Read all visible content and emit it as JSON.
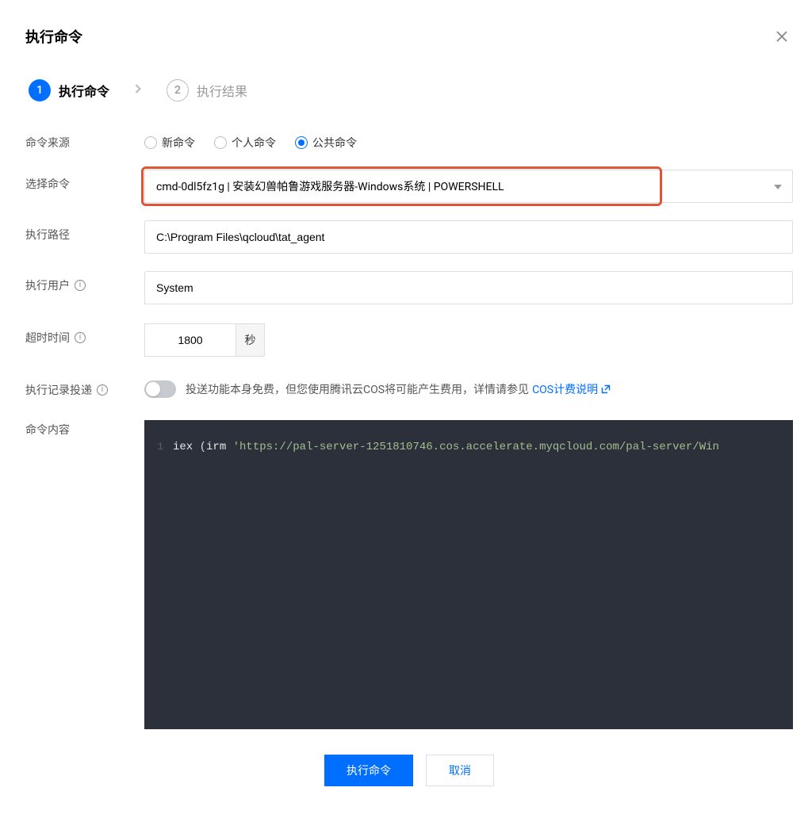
{
  "header": {
    "title": "执行命令"
  },
  "steps": {
    "s1": {
      "num": "1",
      "label": "执行命令"
    },
    "s2": {
      "num": "2",
      "label": "执行结果"
    }
  },
  "labels": {
    "source": "命令来源",
    "select": "选择命令",
    "path": "执行路径",
    "user": "执行用户",
    "timeout": "超时时间",
    "delivery": "执行记录投递",
    "content": "命令内容"
  },
  "source_options": {
    "new": "新命令",
    "personal": "个人命令",
    "public": "公共命令"
  },
  "select_command": {
    "value": "cmd-0dl5fz1g | 安装幻兽帕鲁游戏服务器-Windows系统 | POWERSHELL"
  },
  "path": {
    "value": "C:\\Program Files\\qcloud\\tat_agent"
  },
  "user": {
    "value": "System"
  },
  "timeout": {
    "value": "1800",
    "unit": "秒"
  },
  "delivery": {
    "text_before": "投送功能本身免费，但您使用腾讯云COS将可能产生费用，详情请参见",
    "link": "COS计费说明"
  },
  "code": {
    "line_num": "1",
    "kw": "iex ",
    "paren_open": "(",
    "irm": "irm ",
    "url": "'https://pal-server-1251810746.cos.accelerate.myqcloud.com/pal-server/Win"
  },
  "buttons": {
    "primary": "执行命令",
    "secondary": "取消"
  }
}
